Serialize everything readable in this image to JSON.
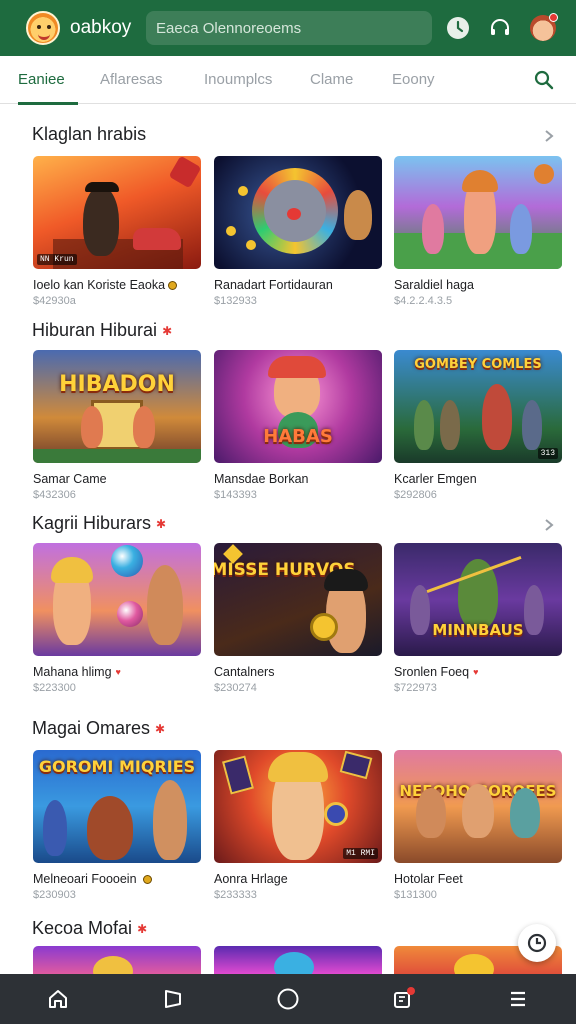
{
  "header": {
    "app_name": "oabkoy",
    "search_placeholder": "Eaeca Olennoreoems",
    "icons": [
      "logo-icon",
      "clock-icon",
      "headset-icon",
      "profile-avatar"
    ]
  },
  "tabs": [
    {
      "label": "Eaniee",
      "active": true
    },
    {
      "label": "Aflaresas",
      "active": false
    },
    {
      "label": "Inoumplcs",
      "active": false
    },
    {
      "label": "Clame",
      "active": false
    },
    {
      "label": "Eoony",
      "active": false
    }
  ],
  "sections": [
    {
      "title": "Klaglan hrabis",
      "has_star": false,
      "cards": [
        {
          "name": "Ioelo kan Koriste Eaoka",
          "meta": "$42930a",
          "coin": true,
          "tag": "NN Krun"
        },
        {
          "name": "Ranadart Fortidauran",
          "meta": "$132933",
          "coin": false,
          "tag": ""
        },
        {
          "name": "Saraldiel haga",
          "meta": "$4.2.2.4.3.5",
          "coin": false,
          "tag": ""
        }
      ]
    },
    {
      "title": "Hiburan Hiburai",
      "has_star": true,
      "cards": [
        {
          "name": "Samar Came",
          "meta": "$432306",
          "coin": false,
          "tag": "",
          "thumb_text": "HIBADON"
        },
        {
          "name": "Mansdae Borkan",
          "meta": "$143393",
          "coin": false,
          "tag": "",
          "thumb_text": "HABAS"
        },
        {
          "name": "Kcarler Emgen",
          "meta": "$292806",
          "coin": false,
          "tag": "313",
          "thumb_text": "GOMBEY COMLES"
        }
      ]
    },
    {
      "title": "Kagrii Hiburars",
      "has_star": true,
      "cards": [
        {
          "name": "Mahana hlimg",
          "meta": "$223300",
          "coin": false,
          "star": true,
          "tag": ""
        },
        {
          "name": "Cantalners",
          "meta": "$230274",
          "coin": false,
          "tag": "",
          "thumb_text": "MISSE HURVOS"
        },
        {
          "name": "Sronlen Foeq",
          "meta": "$722973",
          "coin": false,
          "star": true,
          "tag": "",
          "thumb_text": "MINNBAUS"
        }
      ]
    },
    {
      "title": "Magai Omares",
      "has_star": true,
      "cards": [
        {
          "name": "Melneoari Foooein",
          "meta": "$230903",
          "coin": true,
          "tag": "",
          "thumb_text": "GOROMI MIQRIES"
        },
        {
          "name": "Aonra Hrlage",
          "meta": "$233333",
          "coin": false,
          "tag": "M1 RMI",
          "thumb_text": ""
        },
        {
          "name": "Hotolar Feet",
          "meta": "$131300",
          "coin": false,
          "tag": "",
          "thumb_text": "NEEOHO GOROEES"
        }
      ]
    },
    {
      "title": "Kecoa Mofai",
      "has_star": true,
      "cards": []
    }
  ],
  "navbar": {
    "items": [
      "home-icon",
      "back-icon",
      "home-circle-icon",
      "recents-icon",
      "menu-icon"
    ]
  },
  "colors": {
    "header": "#1e6b3f",
    "accent": "#1e6b3f",
    "star": "#e53935",
    "navbar": "#2d3136"
  }
}
